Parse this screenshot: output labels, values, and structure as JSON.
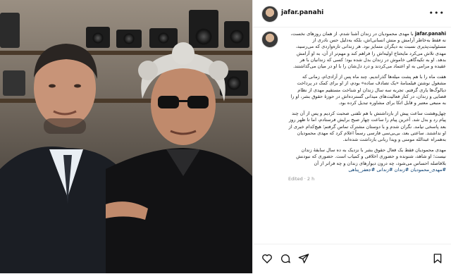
{
  "post": {
    "username": "jafar.panahi",
    "caption_username": "jafar.panahi",
    "paragraphs": [
      "با مهدی محمودیان در زندان آشنا شدم. از همان روزهای نخست، نه فقط به‌خاطر آرامش و منش انسانی‌اش، بلکه به‌دلیل حس نادری از مسئولیت‌پذیری نسبت به دیگران متمایز بود. هر زندانی تازه‌واردی که می‌رسید، مهدی تلاش می‌کرد ما‌یحتاج اولیه‌اش را فراهم کند و مهم‌تر از آن، به او آرامش بدهد. او به تکیه‌گاهی خاموش در زندان بدل شده بود؛ کسی که زندانیان با هر عقیده و مرامی به او اعتماد می‌کردند و درد دل‌شان را با او در میان می‌گذاشتند.",
      "هفت ماه را با هم پشت میله‌ها گذراندیم. چند ماه پس از آزادی‌ام، زمانی که مشغول نوشتن فیلمنامهٔ «یک تصادف ساده» بودم، از او برای کمک در پرداخت دیالوگ‌ها یاری گرفتم. تجربه سه سال زندان او شناخت مستقیم مهدی از نظام قضایی و زندان، در کنار فعالیت‌های میدانی گسترده‌اش در حوزهٔ حقوق بشر، او را به منبعی معتبر و قابل اتکا برای مشاوره تبدیل کرده بود.",
      "چهل‌وهشت ساعت پیش از بازداشتش با هم تلفنی صحبت کردیم و پس از آن چند پیام رد و بدل شد. آخرین پیام را ساعت چهار صبح برایش فرستادم، اما تا ظهر روز بعد پاسخی نیامد. نگران شدم و با دوستان مشترک تماس گرفتم؛ هیچ‌کدام خبری از او نداشتند. ساعتی بعد، بی‌بی‌سی فارسی رسماً اعلام کرد که مهدی محمودیان به‌همراه عبدالله مومنی و ویدا ربانی بازداشت شده‌اند.",
      "مهدی محمودیان فقط یک فعال حقوق بشر با نزدیک به ده سال سابقهٔ زندان نیست؛ او شاهد، شنونده و حضوری اخلاقی و کمیاب است. حضوری که نبودنش بلافاصله احساس می‌شود، چه درون دیوارهای زندان و چه فراتر از آن"
    ],
    "hashtags": "#مهدی_محمودیان #زندان #زندانی #جعفر_پناهی",
    "edited": "Edited · 2 h",
    "more": "•••"
  },
  "colors": {
    "link": "#00376b",
    "muted": "#8e8e8e"
  },
  "actions": [
    "heart-icon",
    "comment-icon",
    "share-icon",
    "bookmark-icon"
  ]
}
